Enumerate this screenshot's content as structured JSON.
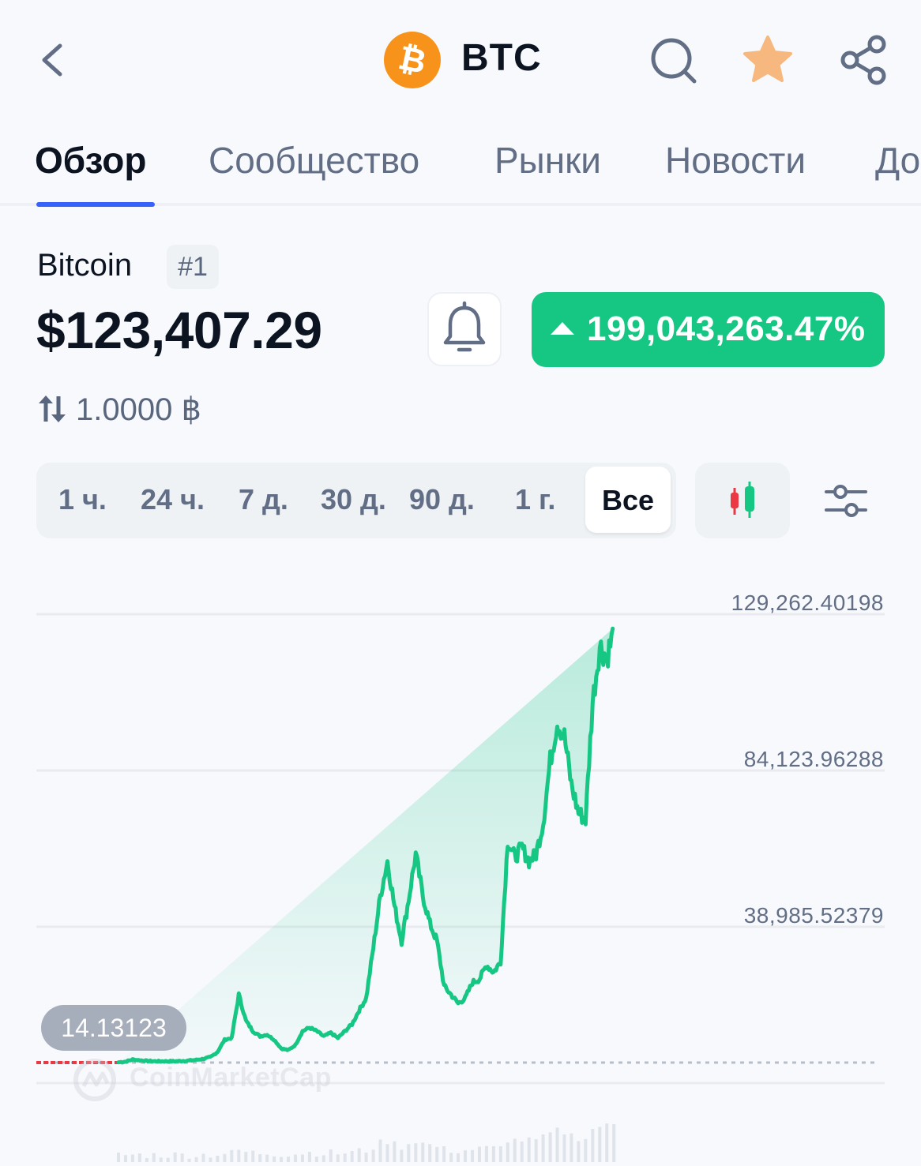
{
  "header": {
    "symbol": "BTC",
    "icons": [
      "back-chevron-icon",
      "bitcoin-logo-icon",
      "search-icon",
      "star-icon",
      "share-icon"
    ],
    "star_color": "#f6b87e",
    "logo_color": "#f7931a"
  },
  "tabs": [
    "Обзор",
    "Сообщество",
    "Рынки",
    "Новости",
    "До"
  ],
  "active_tab": "Обзор",
  "coin": {
    "name": "Bitcoin",
    "rank": "#1",
    "price": "$123,407.29",
    "change": "199,043,263.47%",
    "change_direction": "up",
    "change_color": "#16c784",
    "conversion": "1.0000 ฿"
  },
  "periods": [
    "1 ч.",
    "24 ч.",
    "7 д.",
    "30 д.",
    "90 д.",
    "1 г.",
    "Все"
  ],
  "selected_period": "Все",
  "chart_data": {
    "type": "area",
    "y_tick_labels": [
      "129,262.40198",
      "84,123.96288",
      "38,985.52379"
    ],
    "start_label": "14.13123",
    "watermark": "CoinMarketCap",
    "line_color": "#16c784",
    "ylim": [
      -6000,
      129262
    ],
    "x": [
      0,
      1,
      2,
      3,
      4,
      5,
      6,
      7,
      8,
      9,
      10,
      11,
      12,
      13,
      14,
      15,
      16,
      17,
      18,
      19,
      20,
      21,
      22,
      23,
      24,
      25,
      26,
      27,
      28,
      29,
      30,
      31,
      32,
      33,
      34,
      35,
      36,
      37,
      38,
      39,
      40,
      41,
      42,
      43,
      44,
      45,
      46,
      47,
      48,
      49,
      50,
      51,
      52,
      53,
      54,
      55,
      56,
      57,
      58,
      59,
      60,
      61,
      62,
      63,
      64,
      65,
      66,
      67,
      68,
      69,
      70,
      71,
      72,
      73,
      74,
      75,
      76,
      77,
      78,
      79,
      80,
      81,
      82,
      83,
      84,
      85,
      86,
      87,
      88,
      89,
      90,
      91,
      92,
      93,
      94,
      95,
      96,
      97,
      98,
      99,
      100
    ],
    "values": [
      14,
      200,
      800,
      600,
      400,
      300,
      300,
      300,
      300,
      400,
      500,
      700,
      1000,
      1500,
      3000,
      6500,
      7000,
      19500,
      12000,
      9000,
      7500,
      8000,
      6500,
      4000,
      3500,
      5000,
      9000,
      10000,
      9000,
      7500,
      8500,
      7000,
      9000,
      11000,
      15000,
      18500,
      33000,
      48000,
      58000,
      45000,
      35000,
      47000,
      60000,
      48000,
      40000,
      35000,
      22000,
      19500,
      17000,
      18500,
      23000,
      24000,
      28000,
      26000,
      29000,
      64000,
      59000,
      62000,
      58000,
      60000,
      69000,
      87000,
      98000,
      94000,
      80000,
      72000,
      70000,
      104000,
      120000,
      117000,
      124000
    ]
  }
}
